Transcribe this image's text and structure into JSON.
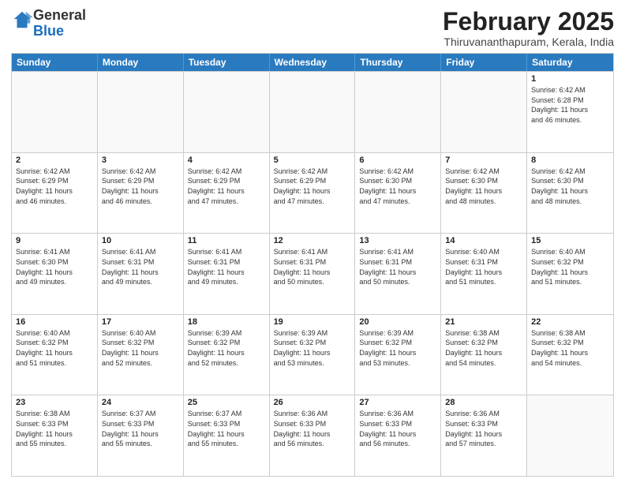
{
  "header": {
    "logo_general": "General",
    "logo_blue": "Blue",
    "month_title": "February 2025",
    "subtitle": "Thiruvananthapuram, Kerala, India"
  },
  "days": [
    "Sunday",
    "Monday",
    "Tuesday",
    "Wednesday",
    "Thursday",
    "Friday",
    "Saturday"
  ],
  "rows": [
    [
      {
        "day": "",
        "info": ""
      },
      {
        "day": "",
        "info": ""
      },
      {
        "day": "",
        "info": ""
      },
      {
        "day": "",
        "info": ""
      },
      {
        "day": "",
        "info": ""
      },
      {
        "day": "",
        "info": ""
      },
      {
        "day": "1",
        "info": "Sunrise: 6:42 AM\nSunset: 6:28 PM\nDaylight: 11 hours\nand 46 minutes."
      }
    ],
    [
      {
        "day": "2",
        "info": "Sunrise: 6:42 AM\nSunset: 6:29 PM\nDaylight: 11 hours\nand 46 minutes."
      },
      {
        "day": "3",
        "info": "Sunrise: 6:42 AM\nSunset: 6:29 PM\nDaylight: 11 hours\nand 46 minutes."
      },
      {
        "day": "4",
        "info": "Sunrise: 6:42 AM\nSunset: 6:29 PM\nDaylight: 11 hours\nand 47 minutes."
      },
      {
        "day": "5",
        "info": "Sunrise: 6:42 AM\nSunset: 6:29 PM\nDaylight: 11 hours\nand 47 minutes."
      },
      {
        "day": "6",
        "info": "Sunrise: 6:42 AM\nSunset: 6:30 PM\nDaylight: 11 hours\nand 47 minutes."
      },
      {
        "day": "7",
        "info": "Sunrise: 6:42 AM\nSunset: 6:30 PM\nDaylight: 11 hours\nand 48 minutes."
      },
      {
        "day": "8",
        "info": "Sunrise: 6:42 AM\nSunset: 6:30 PM\nDaylight: 11 hours\nand 48 minutes."
      }
    ],
    [
      {
        "day": "9",
        "info": "Sunrise: 6:41 AM\nSunset: 6:30 PM\nDaylight: 11 hours\nand 49 minutes."
      },
      {
        "day": "10",
        "info": "Sunrise: 6:41 AM\nSunset: 6:31 PM\nDaylight: 11 hours\nand 49 minutes."
      },
      {
        "day": "11",
        "info": "Sunrise: 6:41 AM\nSunset: 6:31 PM\nDaylight: 11 hours\nand 49 minutes."
      },
      {
        "day": "12",
        "info": "Sunrise: 6:41 AM\nSunset: 6:31 PM\nDaylight: 11 hours\nand 50 minutes."
      },
      {
        "day": "13",
        "info": "Sunrise: 6:41 AM\nSunset: 6:31 PM\nDaylight: 11 hours\nand 50 minutes."
      },
      {
        "day": "14",
        "info": "Sunrise: 6:40 AM\nSunset: 6:31 PM\nDaylight: 11 hours\nand 51 minutes."
      },
      {
        "day": "15",
        "info": "Sunrise: 6:40 AM\nSunset: 6:32 PM\nDaylight: 11 hours\nand 51 minutes."
      }
    ],
    [
      {
        "day": "16",
        "info": "Sunrise: 6:40 AM\nSunset: 6:32 PM\nDaylight: 11 hours\nand 51 minutes."
      },
      {
        "day": "17",
        "info": "Sunrise: 6:40 AM\nSunset: 6:32 PM\nDaylight: 11 hours\nand 52 minutes."
      },
      {
        "day": "18",
        "info": "Sunrise: 6:39 AM\nSunset: 6:32 PM\nDaylight: 11 hours\nand 52 minutes."
      },
      {
        "day": "19",
        "info": "Sunrise: 6:39 AM\nSunset: 6:32 PM\nDaylight: 11 hours\nand 53 minutes."
      },
      {
        "day": "20",
        "info": "Sunrise: 6:39 AM\nSunset: 6:32 PM\nDaylight: 11 hours\nand 53 minutes."
      },
      {
        "day": "21",
        "info": "Sunrise: 6:38 AM\nSunset: 6:32 PM\nDaylight: 11 hours\nand 54 minutes."
      },
      {
        "day": "22",
        "info": "Sunrise: 6:38 AM\nSunset: 6:32 PM\nDaylight: 11 hours\nand 54 minutes."
      }
    ],
    [
      {
        "day": "23",
        "info": "Sunrise: 6:38 AM\nSunset: 6:33 PM\nDaylight: 11 hours\nand 55 minutes."
      },
      {
        "day": "24",
        "info": "Sunrise: 6:37 AM\nSunset: 6:33 PM\nDaylight: 11 hours\nand 55 minutes."
      },
      {
        "day": "25",
        "info": "Sunrise: 6:37 AM\nSunset: 6:33 PM\nDaylight: 11 hours\nand 55 minutes."
      },
      {
        "day": "26",
        "info": "Sunrise: 6:36 AM\nSunset: 6:33 PM\nDaylight: 11 hours\nand 56 minutes."
      },
      {
        "day": "27",
        "info": "Sunrise: 6:36 AM\nSunset: 6:33 PM\nDaylight: 11 hours\nand 56 minutes."
      },
      {
        "day": "28",
        "info": "Sunrise: 6:36 AM\nSunset: 6:33 PM\nDaylight: 11 hours\nand 57 minutes."
      },
      {
        "day": "",
        "info": ""
      }
    ]
  ]
}
